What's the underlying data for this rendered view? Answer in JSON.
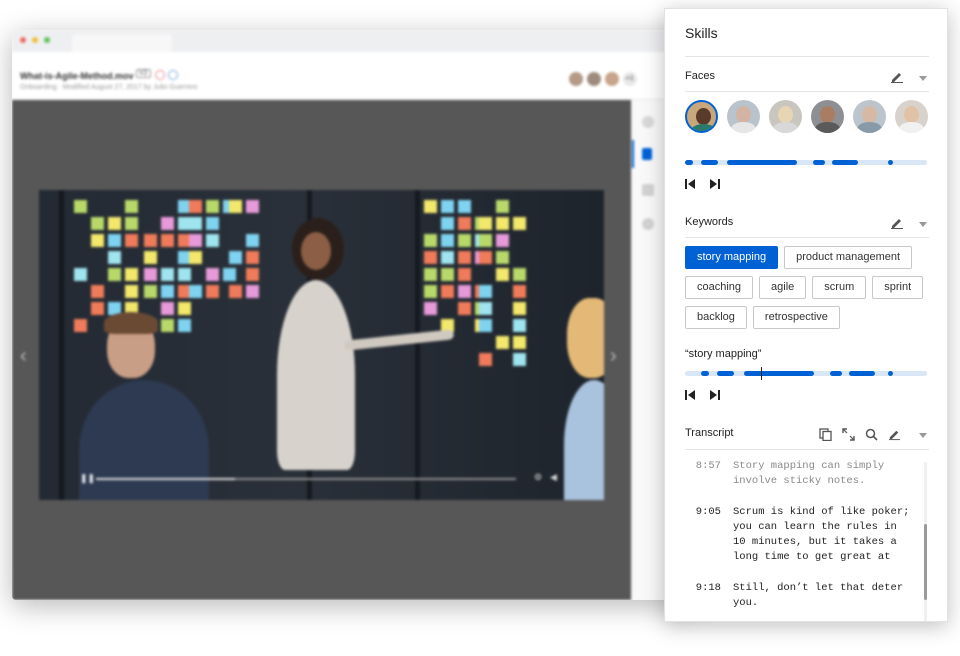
{
  "window": {
    "file_title": "What-is-Agile-Method.mov",
    "version_badge": "V2",
    "subtitle": "Onboarding · Modified August 27, 2017 by Julio Guerrero",
    "collaborator_count": "+1",
    "more_label": "···"
  },
  "player": {
    "prev_icon": "chevron-left-icon",
    "next_icon": "chevron-right-icon",
    "progress": 0.33
  },
  "panel": {
    "title": "Skills",
    "faces": {
      "title": "Faces",
      "people": [
        {
          "name": "face-1",
          "active": true
        },
        {
          "name": "face-2",
          "active": false
        },
        {
          "name": "face-3",
          "active": false
        },
        {
          "name": "face-4",
          "active": false
        },
        {
          "name": "face-5",
          "active": false
        },
        {
          "name": "face-6",
          "active": false
        }
      ]
    },
    "keywords": {
      "title": "Keywords",
      "rows": [
        [
          "story mapping",
          "product management"
        ],
        [
          "coaching",
          "agile",
          "scrum",
          "sprint"
        ],
        [
          "backlog",
          "retrospective"
        ]
      ],
      "selected": "story mapping",
      "selected_label": "“story mapping”"
    },
    "transcript": {
      "title": "Transcript",
      "entries": [
        {
          "time": "8:57",
          "text": "Story mapping can simply involve sticky notes.",
          "faded": true
        },
        {
          "time": "9:05",
          "text": "Scrum is kind of like poker; you can learn the rules in 10 minutes, but it takes a long time to get great at",
          "faded": false
        },
        {
          "time": "9:18",
          "text": "Still, don’t let that deter you.",
          "faded": false
        }
      ]
    }
  },
  "colors": {
    "accent": "#0061d5",
    "timeline_bg": "#d8e6f6"
  }
}
